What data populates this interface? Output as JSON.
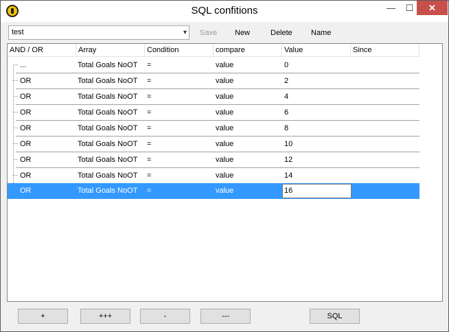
{
  "window": {
    "title": "SQL confitions",
    "controls": {
      "minimize": "—",
      "maximize": "☐",
      "close": "✕"
    }
  },
  "toolbar": {
    "selected_query": "test",
    "save_label": "Save",
    "new_label": "New",
    "delete_label": "Delete",
    "name_label": "Name"
  },
  "grid": {
    "columns": [
      "AND / OR",
      "Array",
      "Condition",
      "compare",
      "Value",
      "Since"
    ],
    "rows": [
      {
        "andor": "...",
        "array": "Total Goals NoOT",
        "condition": "=",
        "compare": "value",
        "value": "0",
        "since": ""
      },
      {
        "andor": "OR",
        "array": "Total Goals NoOT",
        "condition": "=",
        "compare": "value",
        "value": "2",
        "since": ""
      },
      {
        "andor": "OR",
        "array": "Total Goals NoOT",
        "condition": "=",
        "compare": "value",
        "value": "4",
        "since": ""
      },
      {
        "andor": "OR",
        "array": "Total Goals NoOT",
        "condition": "=",
        "compare": "value",
        "value": "6",
        "since": ""
      },
      {
        "andor": "OR",
        "array": "Total Goals NoOT",
        "condition": "=",
        "compare": "value",
        "value": "8",
        "since": ""
      },
      {
        "andor": "OR",
        "array": "Total Goals NoOT",
        "condition": "=",
        "compare": "value",
        "value": "10",
        "since": ""
      },
      {
        "andor": "OR",
        "array": "Total Goals NoOT",
        "condition": "=",
        "compare": "value",
        "value": "12",
        "since": ""
      },
      {
        "andor": "OR",
        "array": "Total Goals NoOT",
        "condition": "=",
        "compare": "value",
        "value": "14",
        "since": ""
      },
      {
        "andor": "OR",
        "array": "Total Goals NoOT",
        "condition": "=",
        "compare": "value",
        "value": "16",
        "since": ""
      }
    ],
    "selected_row": 8
  },
  "buttons": {
    "add": "+",
    "add_many": "+++",
    "remove": "-",
    "remove_many": "---",
    "sql": "SQL"
  },
  "colors": {
    "selection": "#3399ff",
    "close_button": "#c7504b"
  }
}
